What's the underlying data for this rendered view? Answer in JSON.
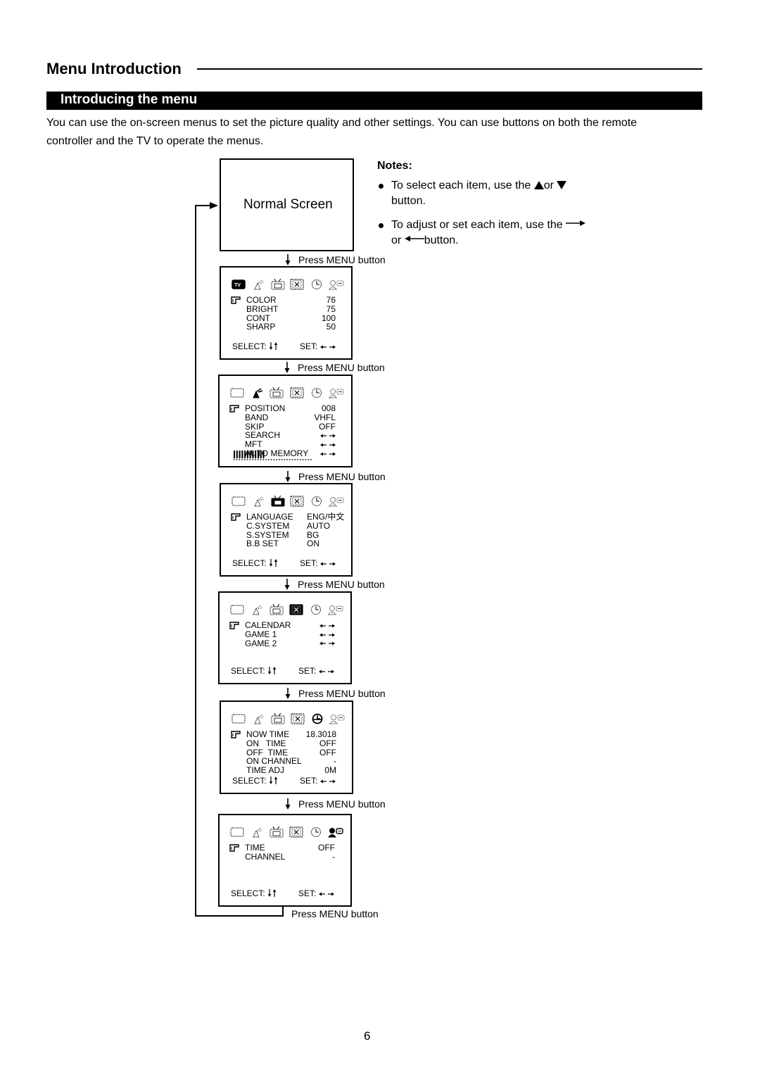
{
  "section_title": "Menu Introduction",
  "subsection_title": "Introducing the menu",
  "intro_text": "You can use the on-screen menus to set the picture quality and other settings. You can use buttons on both the remote controller and the TV to operate the menus.",
  "normal_screen_label": "Normal Screen",
  "press_menu_label": "Press MENU button",
  "notes": {
    "title": "Notes:",
    "items": [
      {
        "before": "To select each item, use the",
        "mid": "or",
        "after": "button.",
        "icons": [
          "up-triangle",
          "down-triangle"
        ]
      },
      {
        "before": "To adjust or set each item, use the",
        "mid": "or",
        "after": "button.",
        "icons": [
          "right-arrow",
          "left-arrow"
        ]
      }
    ]
  },
  "menu_footer": {
    "select_label": "SELECT:",
    "set_label": "SET:"
  },
  "menu_icons": [
    "picture-icon",
    "tuning-antenna-icon",
    "tv-function-icon",
    "feature-icon",
    "timer-clock-icon",
    "child-lock-icon"
  ],
  "menus": [
    {
      "name": "picture-menu",
      "active_icon": 0,
      "rows": [
        {
          "label": "COLOR",
          "value": "76"
        },
        {
          "label": "BRIGHT",
          "value": "75"
        },
        {
          "label": "CONT",
          "value": "100"
        },
        {
          "label": "SHARP",
          "value": "50"
        }
      ]
    },
    {
      "name": "tuning-menu",
      "active_icon": 1,
      "rows": [
        {
          "label": "POSITION",
          "value": "008"
        },
        {
          "label": "BAND",
          "value": "VHFL"
        },
        {
          "label": "SKIP",
          "value": "OFF"
        },
        {
          "label": "SEARCH",
          "value": "←→"
        },
        {
          "label": "MFT",
          "value": "←→"
        },
        {
          "label": "AUTO MEMORY",
          "value": "←→"
        }
      ],
      "progress_fraction": 0.4
    },
    {
      "name": "function-menu",
      "active_icon": 2,
      "rows": [
        {
          "label": "LANGUAGE",
          "value": "ENG/中文"
        },
        {
          "label": "C.SYSTEM",
          "value": "AUTO"
        },
        {
          "label": "S.SYSTEM",
          "value": "BG"
        },
        {
          "label": "B.B SET",
          "value": "ON"
        }
      ]
    },
    {
      "name": "feature-menu",
      "active_icon": 3,
      "rows": [
        {
          "label": "CALENDAR",
          "value": "←→"
        },
        {
          "label": "GAME 1",
          "value": "←→"
        },
        {
          "label": "GAME 2",
          "value": "←→"
        }
      ]
    },
    {
      "name": "timer-menu",
      "active_icon": 4,
      "rows": [
        {
          "label": "NOW TIME",
          "value": "18.3018"
        },
        {
          "label": "ON   TIME",
          "value": "OFF"
        },
        {
          "label": "OFF  TIME",
          "value": "OFF"
        },
        {
          "label": "ON CHANNEL",
          "value": "-"
        },
        {
          "label": "TIME ADJ",
          "value": "0M"
        }
      ]
    },
    {
      "name": "child-lock-menu",
      "active_icon": 5,
      "rows": [
        {
          "label": "TIME",
          "value": "OFF"
        },
        {
          "label": "CHANNEL",
          "value": "-"
        }
      ]
    }
  ],
  "page_number": "6"
}
